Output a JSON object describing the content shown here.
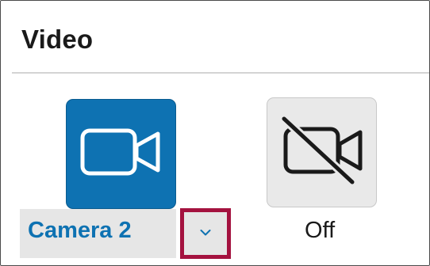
{
  "section": {
    "title": "Video"
  },
  "camera_on": {
    "label": "Camera 2",
    "icon": "video-camera-icon",
    "accent_color": "#0e72b2",
    "selected": true
  },
  "camera_off": {
    "label": "Off",
    "icon": "video-camera-off-icon",
    "selected": false
  },
  "dropdown": {
    "icon": "chevron-down-icon",
    "highlight_color": "#a4123f"
  }
}
